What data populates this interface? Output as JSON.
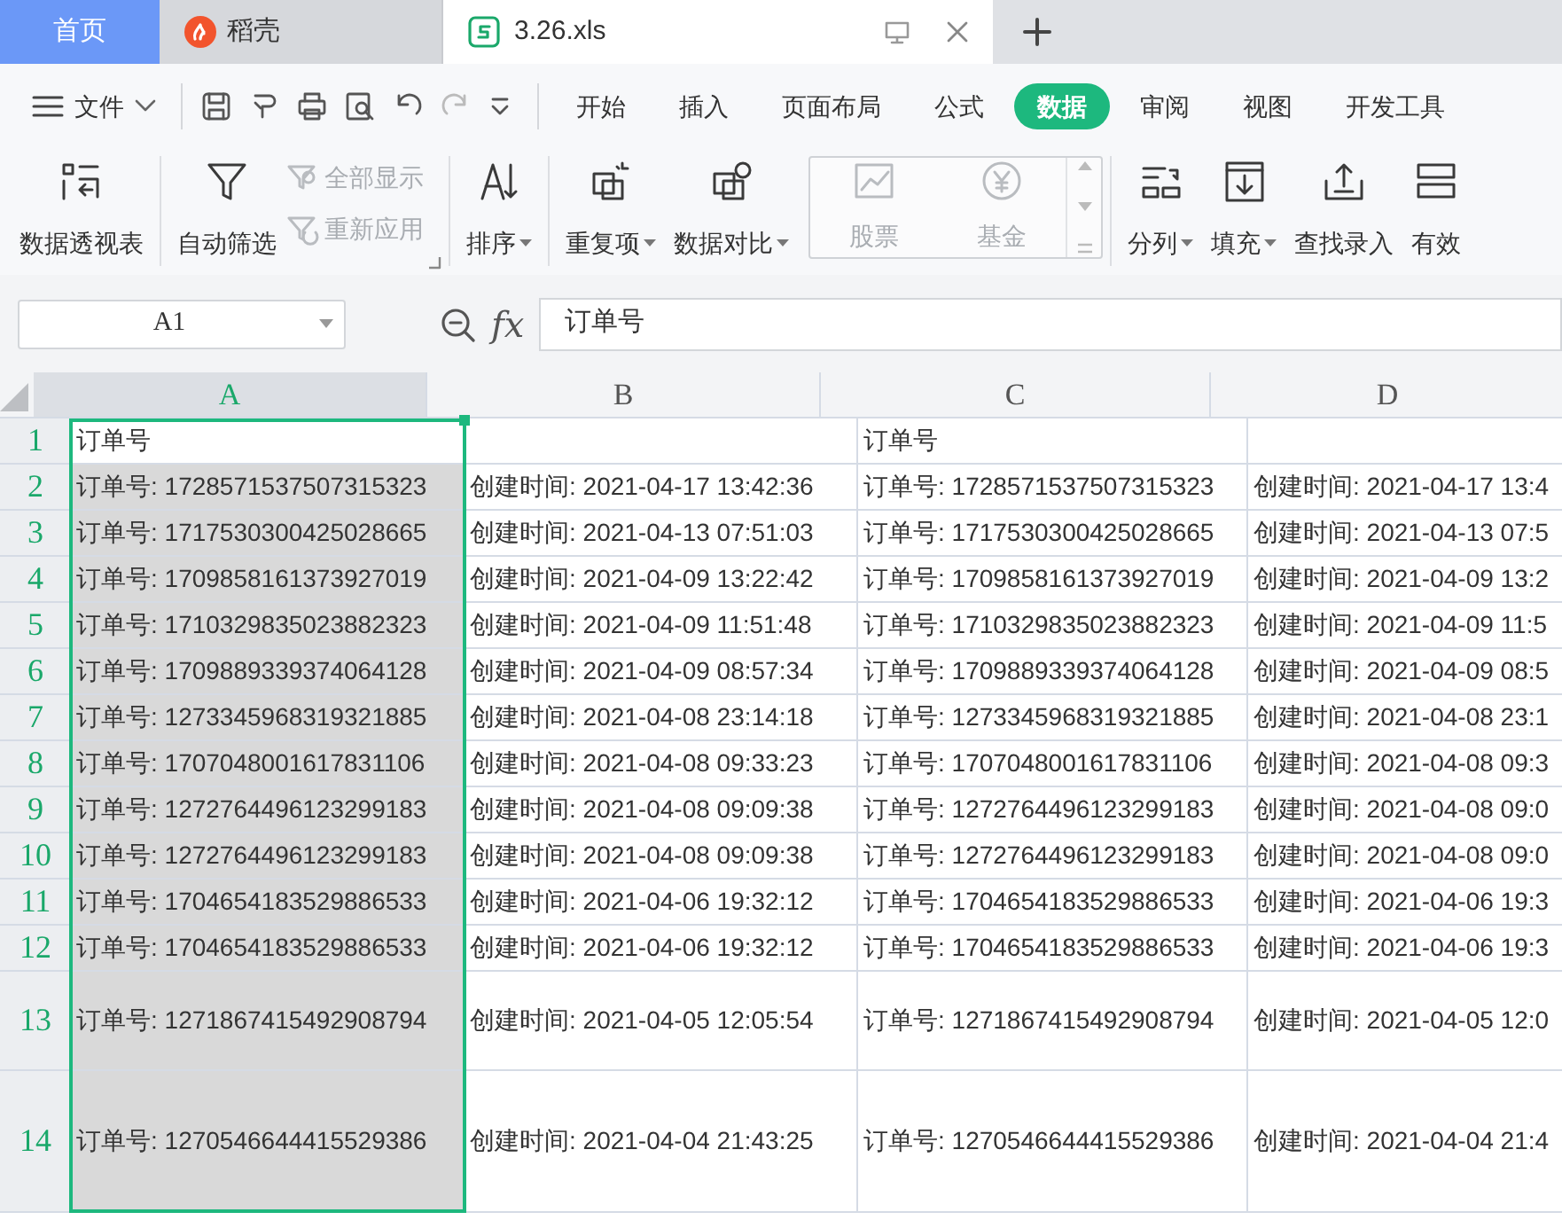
{
  "tabs": [
    {
      "label": "首页",
      "kind": "home",
      "selected": false
    },
    {
      "label": "稻壳",
      "kind": "app",
      "selected": false
    },
    {
      "label": "3.26.xls",
      "kind": "file",
      "selected": true
    }
  ],
  "file_menu": {
    "label": "文件"
  },
  "ribbon_tabs": [
    {
      "label": "开始",
      "selected": false
    },
    {
      "label": "插入",
      "selected": false
    },
    {
      "label": "页面布局",
      "selected": false
    },
    {
      "label": "公式",
      "selected": false
    },
    {
      "label": "数据",
      "selected": true
    },
    {
      "label": "审阅",
      "selected": false
    },
    {
      "label": "视图",
      "selected": false
    },
    {
      "label": "开发工具",
      "selected": false
    }
  ],
  "ribbon_groups": [
    {
      "items": [
        {
          "kind": "large",
          "label": "数据透视表",
          "disabled": false,
          "dropdown": false
        }
      ]
    },
    {
      "launcher": true,
      "items": [
        {
          "kind": "large",
          "label": "自动筛选",
          "disabled": false,
          "dropdown": false
        },
        {
          "kind": "small",
          "label": "全部显示",
          "disabled": true,
          "dropdown": false
        },
        {
          "kind": "small",
          "label": "重新应用",
          "disabled": true,
          "dropdown": false
        }
      ]
    },
    {
      "items": [
        {
          "kind": "large",
          "label": "排序",
          "disabled": false,
          "dropdown": true
        }
      ]
    },
    {
      "items": [
        {
          "kind": "large",
          "label": "重复项",
          "disabled": false,
          "dropdown": true
        },
        {
          "kind": "large",
          "label": "数据对比",
          "disabled": false,
          "dropdown": true
        },
        {
          "kind": "gallery",
          "label": "股票",
          "disabled": true,
          "dropdown": false
        },
        {
          "kind": "gallery",
          "label": "基金",
          "disabled": true,
          "dropdown": false
        }
      ]
    },
    {
      "items": [
        {
          "kind": "large",
          "label": "分列",
          "disabled": false,
          "dropdown": true
        },
        {
          "kind": "large",
          "label": "填充",
          "disabled": false,
          "dropdown": true
        },
        {
          "kind": "large",
          "label": "查找录入",
          "disabled": false,
          "dropdown": false
        },
        {
          "kind": "large",
          "label": "有效",
          "disabled": false,
          "dropdown": false
        }
      ]
    }
  ],
  "name_box": {
    "value": "A1"
  },
  "formula_bar": {
    "label": "fx",
    "value": "订单号"
  },
  "sheet": {
    "columns": [
      {
        "label": "A",
        "selected": true
      },
      {
        "label": "B",
        "selected": false
      },
      {
        "label": "C",
        "selected": false
      },
      {
        "label": "D",
        "selected": false
      }
    ],
    "rows": [
      {
        "number": "1",
        "kind": "normal",
        "active": true,
        "cells": [
          "订单号",
          null,
          "订单号",
          null
        ]
      },
      {
        "number": "2",
        "kind": "normal",
        "active": false,
        "cells": [
          "订单号: 1728571537507315323",
          "创建时间: 2021-04-17 13:42:36",
          "订单号: 1728571537507315323",
          "创建时间: 2021-04-17 13:4"
        ]
      },
      {
        "number": "3",
        "kind": "normal",
        "active": false,
        "cells": [
          "订单号: 1717530300425028665",
          "创建时间: 2021-04-13 07:51:03",
          "订单号: 1717530300425028665",
          "创建时间: 2021-04-13 07:5"
        ]
      },
      {
        "number": "4",
        "kind": "normal",
        "active": false,
        "cells": [
          "订单号: 1709858161373927019",
          "创建时间: 2021-04-09 13:22:42",
          "订单号: 1709858161373927019",
          "创建时间: 2021-04-09 13:2"
        ]
      },
      {
        "number": "5",
        "kind": "normal",
        "active": false,
        "cells": [
          "订单号: 1710329835023882323",
          "创建时间: 2021-04-09 11:51:48",
          "订单号: 1710329835023882323",
          "创建时间: 2021-04-09 11:5"
        ]
      },
      {
        "number": "6",
        "kind": "normal",
        "active": false,
        "cells": [
          "订单号: 1709889339374064128",
          "创建时间: 2021-04-09 08:57:34",
          "订单号: 1709889339374064128",
          "创建时间: 2021-04-09 08:5"
        ]
      },
      {
        "number": "7",
        "kind": "normal",
        "active": false,
        "cells": [
          "订单号: 1273345968319321885",
          "创建时间: 2021-04-08 23:14:18",
          "订单号: 1273345968319321885",
          "创建时间: 2021-04-08 23:1"
        ]
      },
      {
        "number": "8",
        "kind": "normal",
        "active": false,
        "cells": [
          "订单号: 1707048001617831106",
          "创建时间: 2021-04-08 09:33:23",
          "订单号: 1707048001617831106",
          "创建时间: 2021-04-08 09:3"
        ]
      },
      {
        "number": "9",
        "kind": "normal",
        "active": false,
        "cells": [
          "订单号: 1272764496123299183",
          "创建时间: 2021-04-08 09:09:38",
          "订单号: 1272764496123299183",
          "创建时间: 2021-04-08 09:0"
        ]
      },
      {
        "number": "10",
        "kind": "normal",
        "active": false,
        "cells": [
          "订单号: 1272764496123299183",
          "创建时间: 2021-04-08 09:09:38",
          "订单号: 1272764496123299183",
          "创建时间: 2021-04-08 09:0"
        ]
      },
      {
        "number": "11",
        "kind": "normal",
        "active": false,
        "cells": [
          "订单号: 1704654183529886533",
          "创建时间: 2021-04-06 19:32:12",
          "订单号: 1704654183529886533",
          "创建时间: 2021-04-06 19:3"
        ]
      },
      {
        "number": "12",
        "kind": "normal",
        "active": false,
        "cells": [
          "订单号: 1704654183529886533",
          "创建时间: 2021-04-06 19:32:12",
          "订单号: 1704654183529886533",
          "创建时间: 2021-04-06 19:3"
        ]
      },
      {
        "number": "13",
        "kind": "tall",
        "active": false,
        "cells": [
          "订单号: 1271867415492908794",
          "创建时间: 2021-04-05 12:05:54",
          "订单号: 1271867415492908794",
          "创建时间: 2021-04-05 12:0"
        ]
      },
      {
        "number": "14",
        "kind": "taller",
        "active": false,
        "cells": [
          "订单号: 1270546644415529386",
          "创建时间: 2021-04-04 21:43:25",
          "订单号: 1270546644415529386",
          "创建时间: 2021-04-04 21:4"
        ]
      }
    ]
  }
}
